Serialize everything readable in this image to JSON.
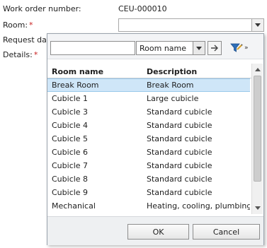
{
  "form": {
    "work_order_label": "Work order number:",
    "work_order_value": "CEU-000010",
    "room_label": "Room:",
    "request_date_label": "Request date",
    "details_label": "Details:",
    "required_marker": "*"
  },
  "lookup": {
    "filter_value": "",
    "field_selected": "Room name",
    "columns": {
      "name": "Room name",
      "description": "Description"
    },
    "rows": [
      {
        "name": "Break Room",
        "description": "Break Room",
        "selected": true
      },
      {
        "name": "Cubicle 1",
        "description": "Large cubicle"
      },
      {
        "name": "Cubicle 3",
        "description": "Standard cubicle"
      },
      {
        "name": "Cubicle 4",
        "description": "Standard cubicle"
      },
      {
        "name": "Cubicle 5",
        "description": "Standard cubicle"
      },
      {
        "name": "Cubicle 6",
        "description": "Standard cubicle"
      },
      {
        "name": "Cubicle 7",
        "description": "Standard cubicle"
      },
      {
        "name": "Cubicle 8",
        "description": "Standard cubicle"
      },
      {
        "name": "Cubicle 9",
        "description": "Standard cubicle"
      },
      {
        "name": "Mechanical",
        "description": "Heating, cooling, plumbing"
      }
    ],
    "ok_label": "OK",
    "cancel_label": "Cancel"
  },
  "colors": {
    "selected_row": "#cfe6f8",
    "required": "#c81e1e",
    "funnel": "#2f6fb8"
  },
  "icons": {
    "go": "arrow-right-icon",
    "filter_options": "funnel-icon"
  }
}
